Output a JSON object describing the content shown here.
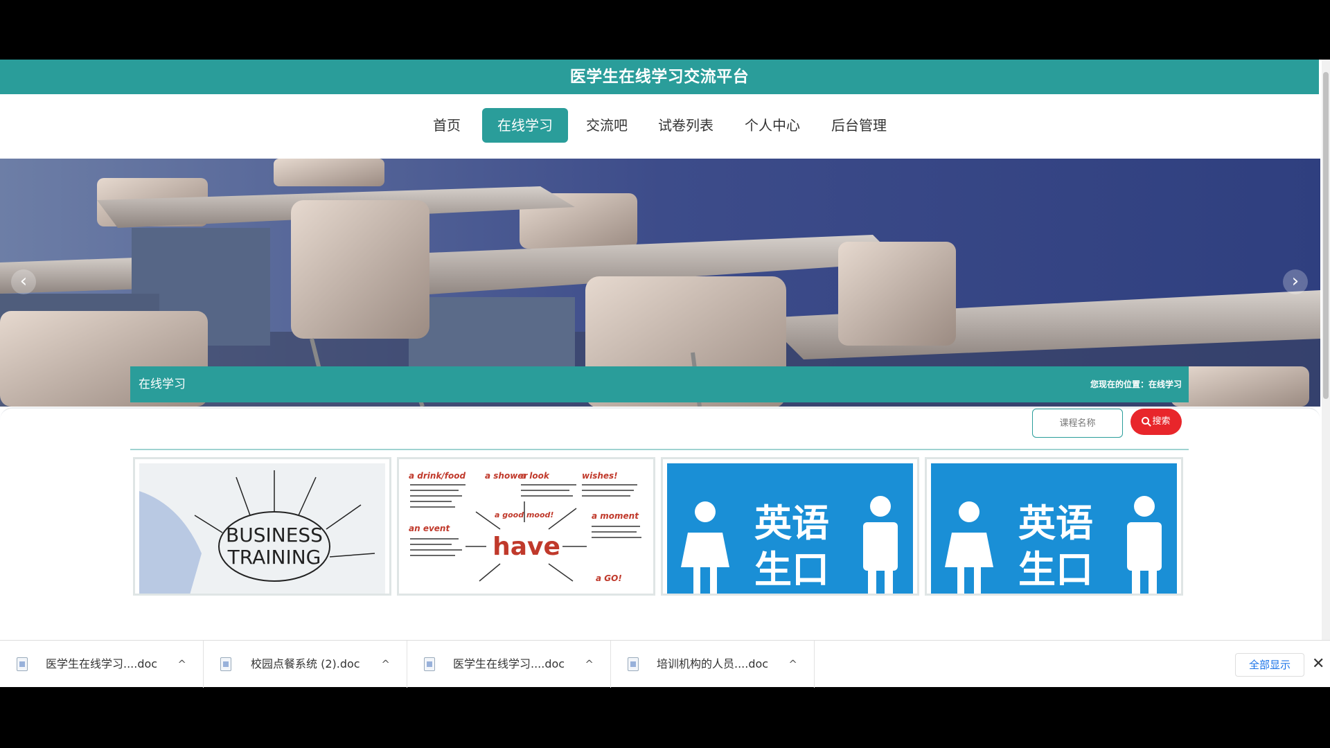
{
  "site": {
    "title": "医学生在线学习交流平台"
  },
  "nav": [
    {
      "label": "首页",
      "active": false
    },
    {
      "label": "在线学习",
      "active": true
    },
    {
      "label": "交流吧",
      "active": false
    },
    {
      "label": "试卷列表",
      "active": false
    },
    {
      "label": "个人中心",
      "active": false
    },
    {
      "label": "后台管理",
      "active": false
    }
  ],
  "banner": {
    "prev_icon": "chevron-left-icon",
    "next_icon": "chevron-right-icon",
    "prev_glyph": "‹",
    "next_glyph": "›"
  },
  "section": {
    "title": "在线学习",
    "breadcrumb": "您现在的位置：在线学习"
  },
  "search": {
    "placeholder": "课程名称",
    "button_label": "搜索"
  },
  "cards": [
    {
      "image_text": [
        "BUSINESS",
        "TRAINING"
      ]
    },
    {
      "image_text": [
        "a drink/food",
        "a shower",
        "a look",
        "wishes!",
        "a good mood!",
        "have",
        "an event",
        "a moment",
        "a GO!"
      ]
    },
    {
      "image_text": [
        "英语",
        "生口"
      ]
    },
    {
      "image_text": [
        "英语",
        "生口"
      ]
    }
  ],
  "downloads": {
    "items": [
      {
        "name": "医学生在线学习....doc"
      },
      {
        "name": "校园点餐系统 (2).doc"
      },
      {
        "name": "医学生在线学习....doc"
      },
      {
        "name": "培训机构的人员....doc"
      }
    ],
    "caret": "^",
    "show_all": "全部显示",
    "close": "✕"
  },
  "colors": {
    "primary": "#2a9d9a",
    "search": "#e8262b",
    "banner": "#3b4f86"
  }
}
